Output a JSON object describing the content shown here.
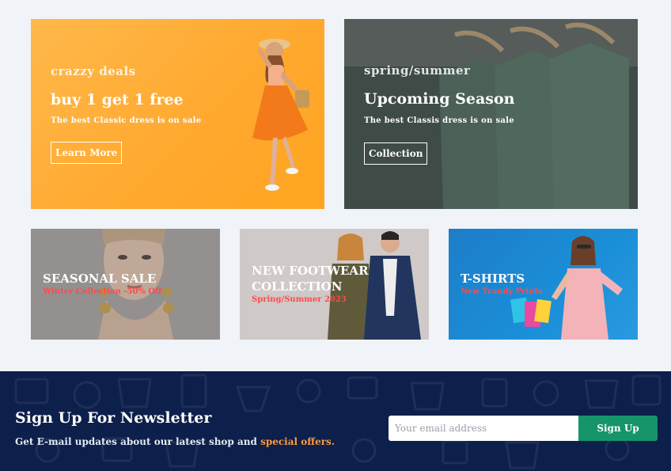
{
  "banners": {
    "deals": {
      "eyebrow": "crazzy deals",
      "headline": "buy 1 get 1 free",
      "subline": "The best Classic dress is on sale",
      "cta": "Learn More"
    },
    "season": {
      "eyebrow": "spring/summer",
      "headline": "Upcoming Season",
      "subline": "The best Classis dress is on sale",
      "cta": "Collection"
    },
    "seasonal_sale": {
      "title": "SEASONAL SALE",
      "sub": "Winter Collection -50% Off"
    },
    "footwear": {
      "title": "NEW FOOTWEAR COLLECTION",
      "sub": "Spring/Summer 2023"
    },
    "tshirts": {
      "title": "T-SHIRTS",
      "sub": "New Trandy Prints"
    }
  },
  "newsletter": {
    "title": "Sign Up For Newsletter",
    "text_prefix": "Get E-mail updates about our latest shop and ",
    "text_highlight": "special offers",
    "text_suffix": ".",
    "placeholder": "Your email address",
    "button": "Sign Up"
  },
  "colors": {
    "page_bg": "#f0f3f8",
    "deals_bg": "#ffa82e",
    "season_bg": "#4f5d57",
    "newsletter_bg": "#0d1f4b",
    "signup_btn": "#16956b",
    "sale_red": "#ff4a4a",
    "highlight_orange": "#ff9a3c"
  }
}
